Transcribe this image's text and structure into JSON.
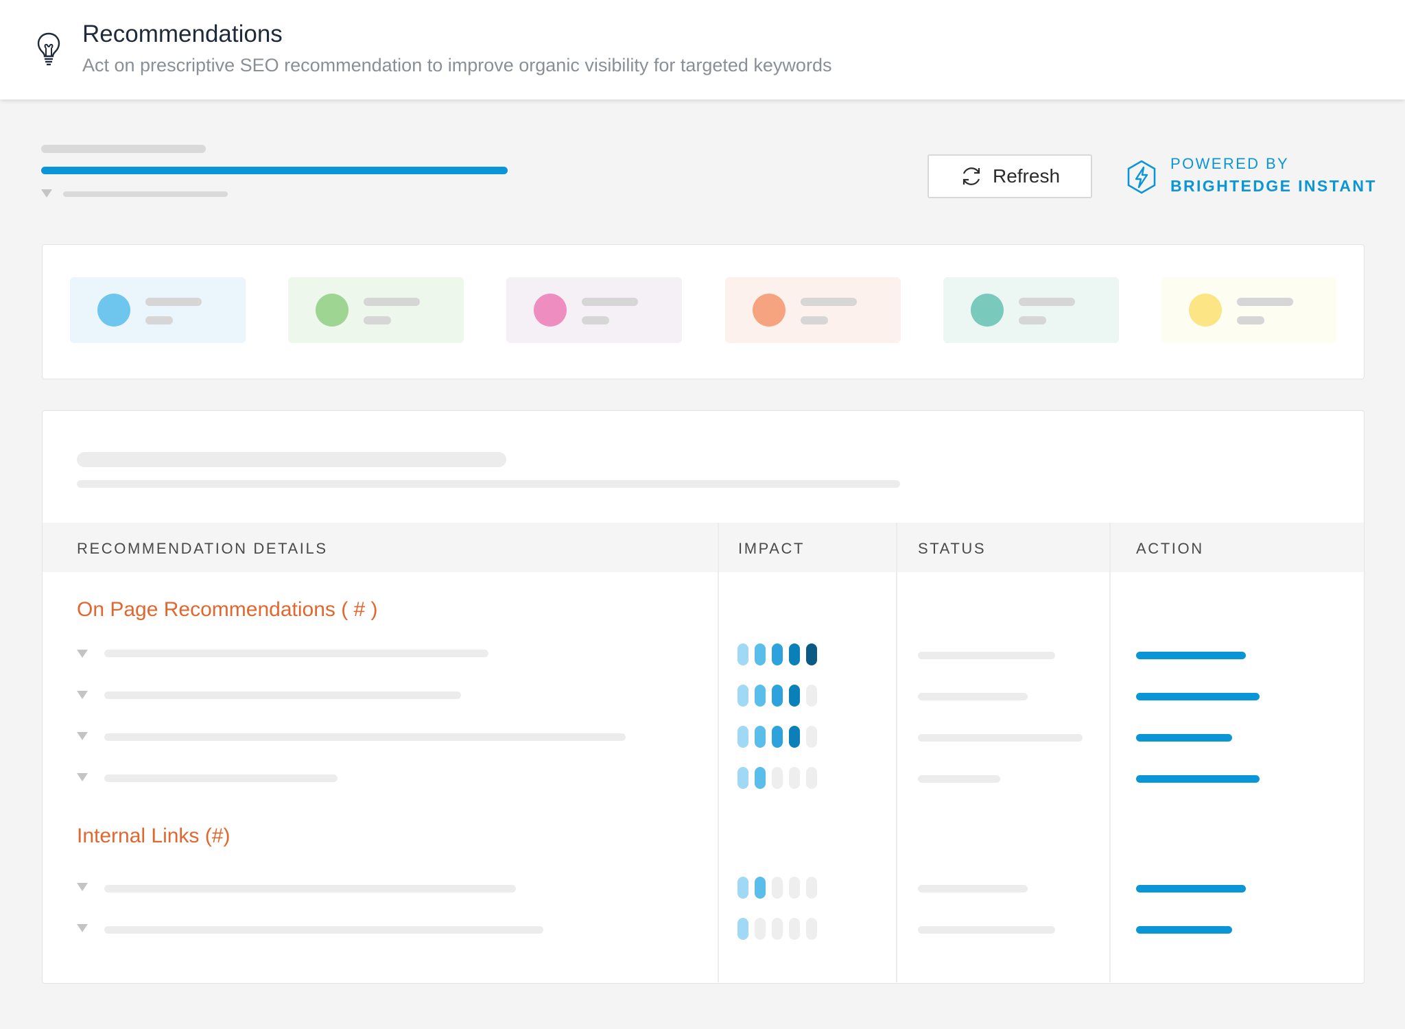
{
  "header": {
    "title": "Recommendations",
    "subtitle": "Act on prescriptive SEO recommendation to improve organic visibility for targeted keywords"
  },
  "toolbar": {
    "refresh_label": "Refresh",
    "powered_line1": "POWERED BY",
    "powered_line2": "BRIGHTEDGE INSTANT"
  },
  "colors": {
    "accent_blue": "#0a96d6",
    "section_orange": "#e2672f",
    "impact_levels": [
      "#9fd9f5",
      "#5bbde9",
      "#2ea2dc",
      "#0a7fb8",
      "#0b5a83"
    ]
  },
  "table": {
    "headers": [
      "RECOMMENDATION DETAILS",
      "IMPACT",
      "STATUS",
      "ACTION"
    ],
    "sections": [
      {
        "title": "On Page Recommendations ( # )",
        "impact_levels": [
          5,
          4,
          4,
          2
        ]
      },
      {
        "title": "Internal Links (#)",
        "impact_levels": [
          2,
          1
        ]
      }
    ]
  }
}
